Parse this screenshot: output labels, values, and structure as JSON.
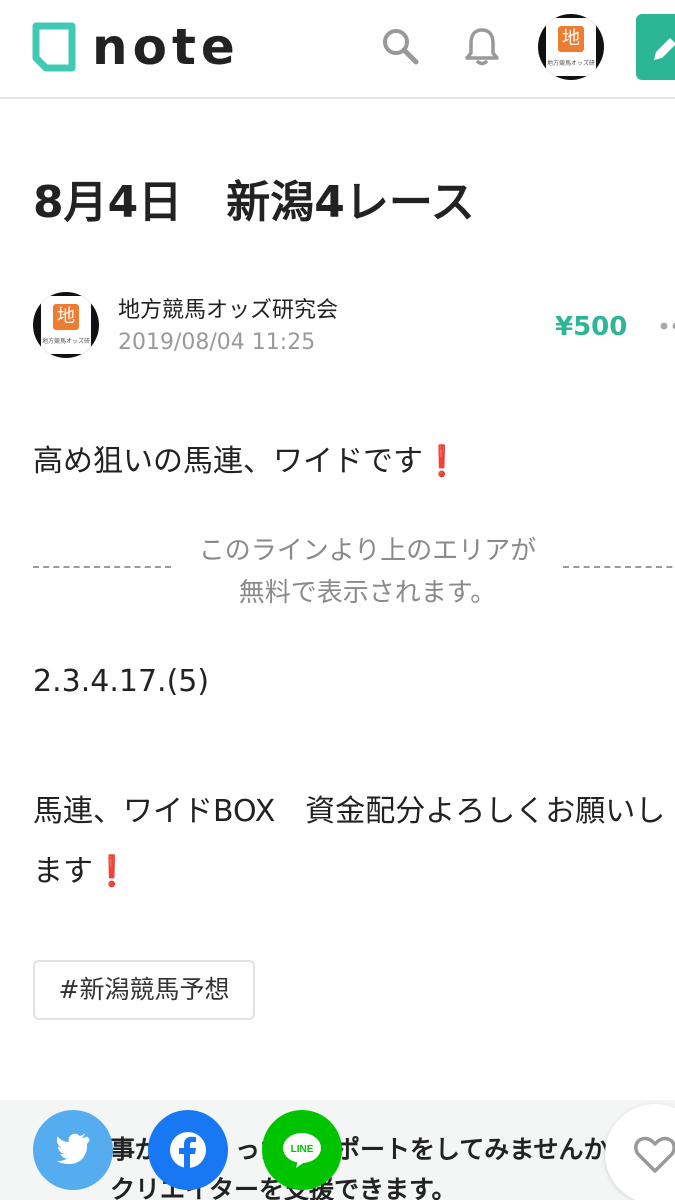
{
  "header": {
    "logo_text": "note",
    "avatar_badge": "地",
    "avatar_caption": "地方競馬オッズ研究会"
  },
  "article": {
    "title": "8月4日　新潟4レース",
    "author_name": "地方競馬オッズ研究会",
    "date": "2019/08/04 11:25",
    "price": "¥500",
    "body": {
      "line1": "高め狙いの馬連、ワイドです",
      "paywall_line1": "このラインより上のエリアが",
      "paywall_line2": "無料で表示されます。",
      "line2": "2.3.4.17.(5)",
      "line3": "馬連、ワイドBOX　資金配分よろしくお願いし",
      "line4": "ます"
    },
    "exclaim": "❗",
    "tag": "#新潟競馬予想"
  },
  "support": {
    "line1": "事が　　　った　　ポートをしてみませんか",
    "line2": "クリエイターを支援できます。",
    "line_label": "LINE"
  },
  "colors": {
    "brand": "#2cb696",
    "twitter": "#55acee",
    "facebook": "#1877f2",
    "line": "#00c300",
    "exclaim": "#e0162b"
  }
}
